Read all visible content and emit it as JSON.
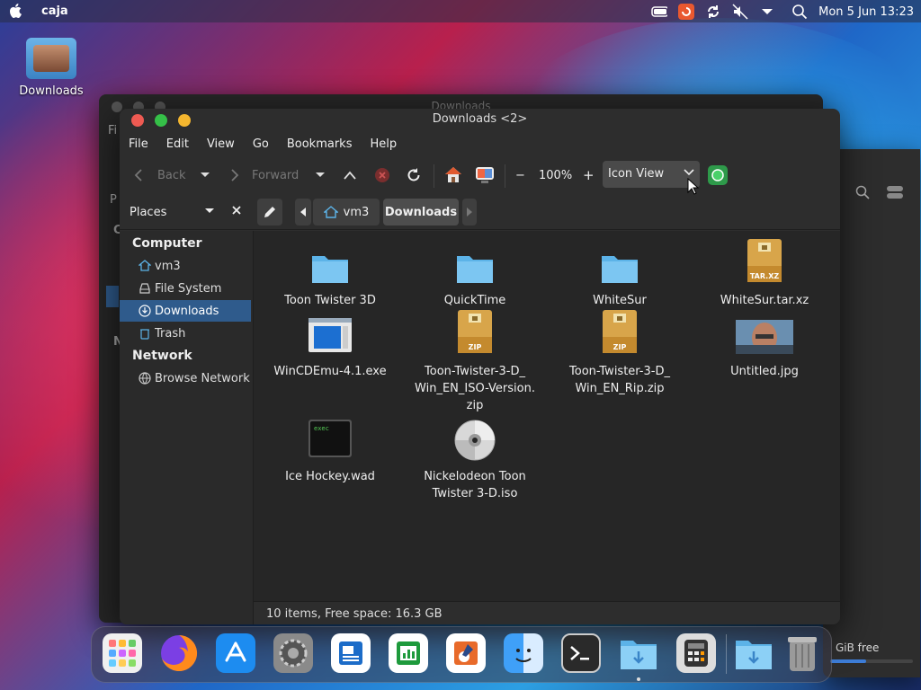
{
  "topbar": {
    "app_name": "caja",
    "clock": "Mon 5 Jun 13:23"
  },
  "desktop": {
    "icons": [
      {
        "label": "Downloads"
      }
    ]
  },
  "back_window": {
    "title": "Downloads",
    "side_letters": [
      "Fi",
      "P",
      "C",
      "N"
    ],
    "free_label": "GiB free"
  },
  "window": {
    "title": "Downloads <2>",
    "menu": [
      "File",
      "Edit",
      "View",
      "Go",
      "Bookmarks",
      "Help"
    ],
    "toolbar": {
      "back_label": "Back",
      "forward_label": "Forward",
      "zoom": "100%",
      "zoom_out": "−",
      "zoom_in": "+",
      "view_mode": "Icon View"
    },
    "places_label": "Places",
    "path": [
      "vm3",
      "Downloads"
    ],
    "sidebar": {
      "computer_heading": "Computer",
      "computer_items": [
        {
          "label": "vm3",
          "icon": "home-icon"
        },
        {
          "label": "File System",
          "icon": "drive-icon"
        },
        {
          "label": "Downloads",
          "icon": "download-icon",
          "selected": true
        },
        {
          "label": "Trash",
          "icon": "trash-icon"
        }
      ],
      "network_heading": "Network",
      "network_items": [
        {
          "label": "Browse Network",
          "icon": "network-icon"
        }
      ]
    },
    "files": [
      {
        "name": "Toon Twister 3D",
        "type": "folder"
      },
      {
        "name": "QuickTime",
        "type": "folder"
      },
      {
        "name": "WhiteSur",
        "type": "folder"
      },
      {
        "name": "WhiteSur.tar.xz",
        "type": "archive",
        "badge": "TAR.XZ"
      },
      {
        "name": "WinCDEmu-4.1.exe",
        "type": "executable"
      },
      {
        "name_lines": [
          "Toon-Twister-3-D_",
          "Win_EN_ISO-Version.",
          "zip"
        ],
        "type": "archive",
        "badge": "ZIP"
      },
      {
        "name_lines": [
          "Toon-Twister-3-D_",
          "Win_EN_Rip.zip"
        ],
        "type": "archive",
        "badge": "ZIP"
      },
      {
        "name": "Untitled.jpg",
        "type": "image"
      },
      {
        "name": "Ice Hockey.wad",
        "type": "exec",
        "badge": "exec"
      },
      {
        "name_lines": [
          "Nickelodeon Toon",
          "Twister 3-D.iso"
        ],
        "type": "disc"
      }
    ],
    "status": "10 items, Free space: 16.3 GB"
  },
  "dock": {
    "apps": [
      "launchpad-icon",
      "firefox-icon",
      "app-store-icon",
      "settings-icon",
      "writer-icon",
      "calc-icon",
      "draw-icon",
      "finder-icon",
      "terminal-icon",
      "downloads-folder-icon",
      "calculator-icon",
      "folder-downloads-icon",
      "trash-icon"
    ]
  },
  "colors": {
    "accent": "#2f5b8c",
    "close": "#ee5a52",
    "maximize": "#35c048",
    "minimize": "#f4b62f",
    "folder": "#5cb3e8"
  }
}
